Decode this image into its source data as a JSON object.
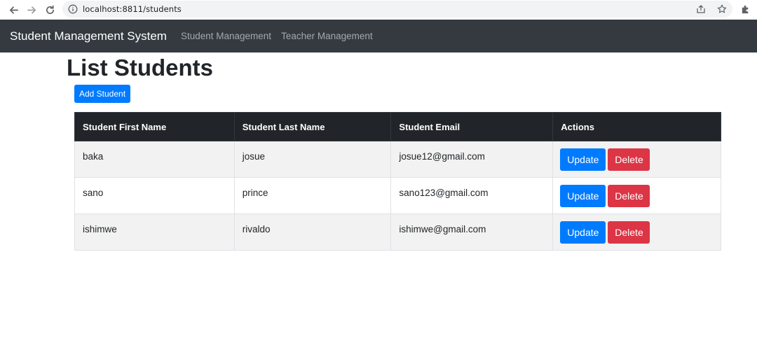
{
  "browser": {
    "url": "localhost:8811/students",
    "icons": [
      "back-arrow-icon",
      "forward-arrow-icon",
      "reload-icon",
      "site-info-icon",
      "share-icon",
      "bookmark-star-icon",
      "extensions-puzzle-icon"
    ]
  },
  "navbar": {
    "brand": "Student Management System",
    "links": [
      "Student Management",
      "Teacher Management"
    ],
    "bg_color": "#343a40"
  },
  "main": {
    "title": "List Students",
    "add_button": "Add Student",
    "table": {
      "headers": [
        "Student First Name",
        "Student Last Name",
        "Student Email",
        "Actions"
      ],
      "rows": [
        {
          "first": "baka",
          "last": "josue",
          "email": "josue12@gmail.com"
        },
        {
          "first": "sano",
          "last": "prince",
          "email": "sano123@gmail.com"
        },
        {
          "first": "ishimwe",
          "last": "rivaldo",
          "email": "ishimwe@gmail.com"
        }
      ],
      "update_label": "Update",
      "delete_label": "Delete"
    }
  },
  "colors": {
    "primary": "#007bff",
    "danger": "#dc3545",
    "table_header": "#212529"
  }
}
